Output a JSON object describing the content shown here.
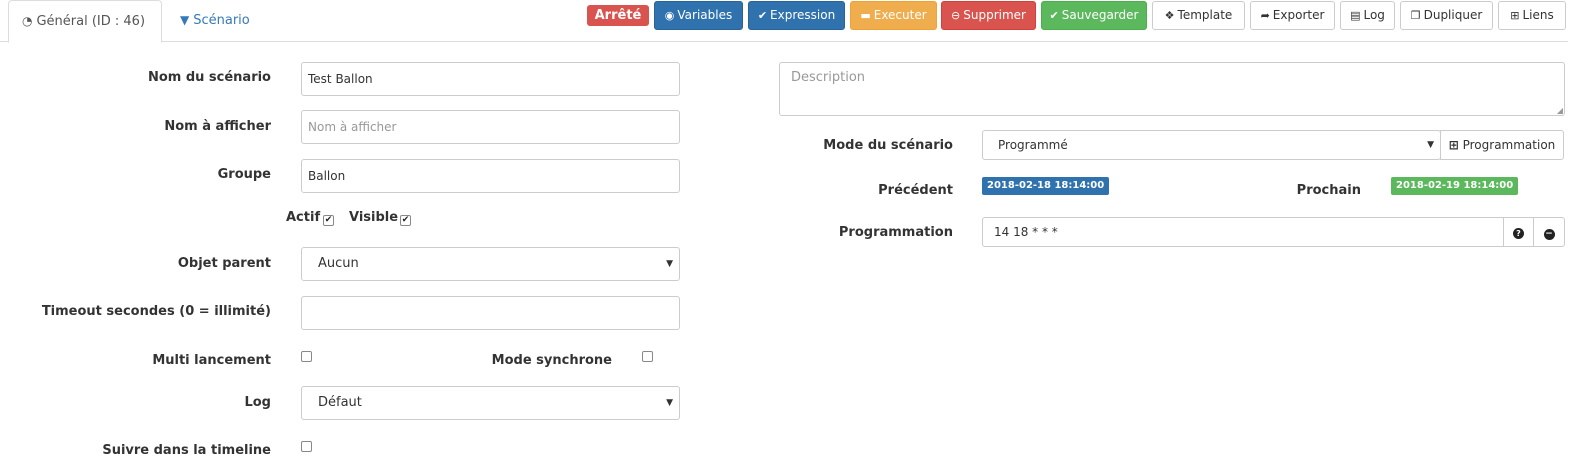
{
  "tabs": [
    {
      "label": "Général (ID : 46)",
      "icon": "dashboard-icon"
    },
    {
      "label": "Scénario",
      "icon": "filter-icon"
    }
  ],
  "toolbar": {
    "status": "Arrêté",
    "variables": "Variables",
    "expression": "Expression",
    "executer": "Executer",
    "supprimer": "Supprimer",
    "sauvegarder": "Sauvegarder",
    "template": "Template",
    "exporter": "Exporter",
    "log": "Log",
    "dupliquer": "Dupliquer",
    "liens": "Liens"
  },
  "form": {
    "nom_label": "Nom du scénario",
    "nom_value": "Test Ballon",
    "afficher_label": "Nom à afficher",
    "afficher_placeholder": "Nom à afficher",
    "groupe_label": "Groupe",
    "groupe_value": "Ballon",
    "actif_label": "Actif",
    "actif_checked": true,
    "visible_label": "Visible",
    "visible_checked": true,
    "parent_label": "Objet parent",
    "parent_value": "Aucun",
    "timeout_label": "Timeout secondes (0 = illimité)",
    "timeout_value": "",
    "multi_label": "Multi lancement",
    "multi_checked": false,
    "sync_label": "Mode synchrone",
    "sync_checked": false,
    "log_label": "Log",
    "log_value": "Défaut",
    "timeline_label": "Suivre dans la timeline",
    "timeline_checked": false
  },
  "right": {
    "description_placeholder": "Description",
    "mode_label": "Mode du scénario",
    "mode_value": "Programmé",
    "programmation_button": "Programmation",
    "precedent_label": "Précédent",
    "precedent_value": "2018-02-18 18:14:00",
    "prochain_label": "Prochain",
    "prochain_value": "2018-02-19 18:14:00",
    "prog_label": "Programmation",
    "prog_value": "14 18 * * *"
  },
  "colors": {
    "primary": "#3072ad",
    "warning": "#f0ad4e",
    "danger": "#d9534f",
    "success": "#5cb85c",
    "link": "#337ab7"
  }
}
